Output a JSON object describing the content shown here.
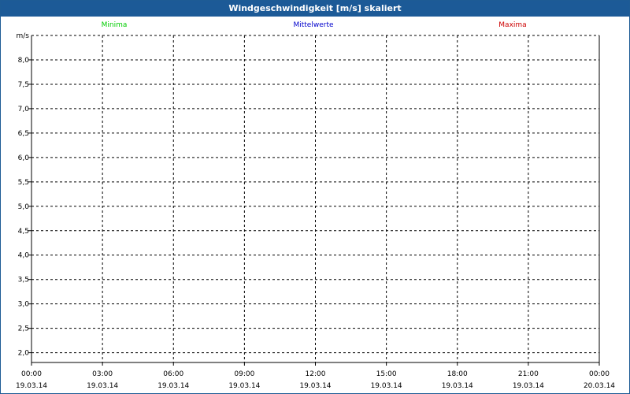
{
  "window": {
    "title": "Windgeschwindigkeit [m/s] skaliert"
  },
  "chart_data": {
    "type": "line",
    "title": "Windgeschwindigkeit [m/s] skaliert",
    "ylabel": "m/s",
    "xlabel": "",
    "ylim": [
      1.8,
      8.5
    ],
    "yticks": [
      "2,0",
      "2,5",
      "3,0",
      "3,5",
      "4,0",
      "4,5",
      "5,0",
      "5,5",
      "6,0",
      "6,5",
      "7,0",
      "7,5",
      "8,0"
    ],
    "ytick_values": [
      2.0,
      2.5,
      3.0,
      3.5,
      4.0,
      4.5,
      5.0,
      5.5,
      6.0,
      6.5,
      7.0,
      7.5,
      8.0
    ],
    "xticks": [
      {
        "time": "00:00",
        "date": "19.03.14"
      },
      {
        "time": "03:00",
        "date": "19.03.14"
      },
      {
        "time": "06:00",
        "date": "19.03.14"
      },
      {
        "time": "09:00",
        "date": "19.03.14"
      },
      {
        "time": "12:00",
        "date": "19.03.14"
      },
      {
        "time": "15:00",
        "date": "19.03.14"
      },
      {
        "time": "18:00",
        "date": "19.03.14"
      },
      {
        "time": "21:00",
        "date": "19.03.14"
      },
      {
        "time": "00:00",
        "date": "20.03.14"
      }
    ],
    "series": [
      {
        "name": "Minima",
        "color": "#00cc00",
        "values": []
      },
      {
        "name": "Mittelwerte",
        "color": "#0000cc",
        "values": []
      },
      {
        "name": "Maxima",
        "color": "#cc0000",
        "values": []
      }
    ],
    "grid": true,
    "grid_style": "dashed",
    "legend": "top"
  }
}
